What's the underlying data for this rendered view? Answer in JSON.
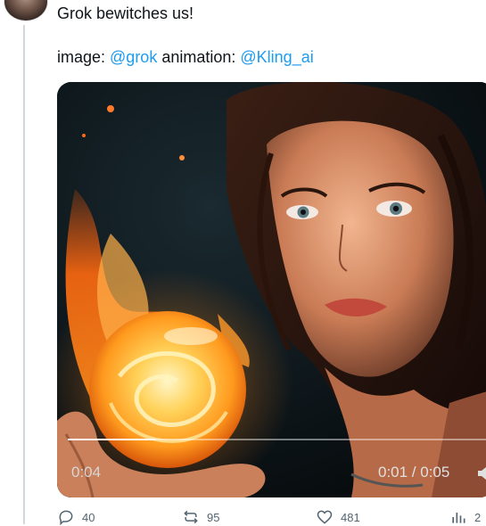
{
  "tweet": {
    "text": "Grok bewitches us!",
    "credit_prefix_image": "image: ",
    "credit_image_handle": "@grok",
    "credit_mid": " animation: ",
    "credit_animation_handle": "@Kling_ai"
  },
  "video": {
    "elapsed_overlay": "0:04",
    "time_display": "0:01 / 0:05",
    "progress": 0.2
  },
  "actions": {
    "reply_count": "40",
    "repost_count": "95",
    "like_count": "481",
    "views_count": "2"
  },
  "colors": {
    "link": "#1d9bf0",
    "fire": "#ffb020"
  },
  "icons": [
    "reply-icon",
    "repost-icon",
    "like-icon",
    "views-icon",
    "volume-icon"
  ]
}
